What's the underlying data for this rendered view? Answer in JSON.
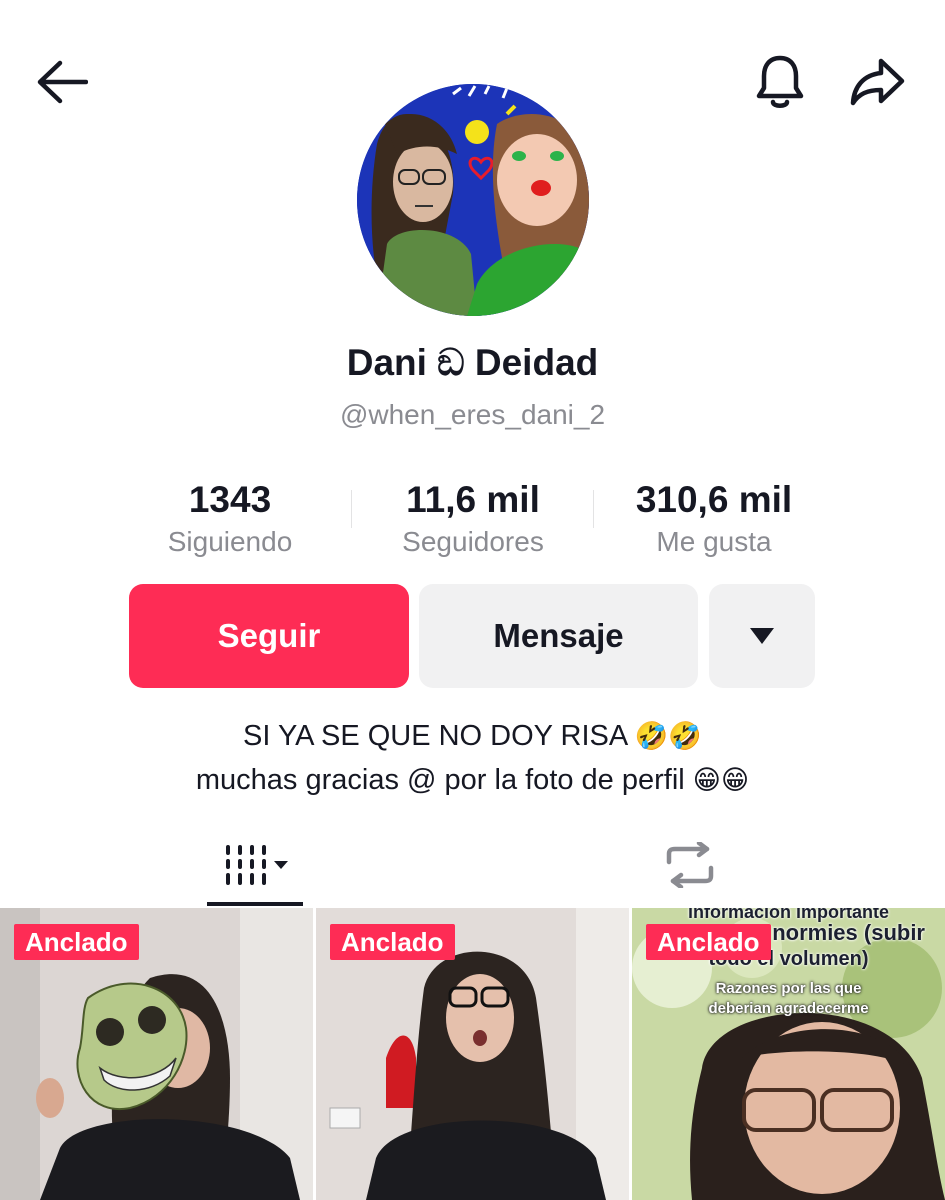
{
  "header": {
    "back_icon": "arrow-left-icon",
    "notification_icon": "bell-icon",
    "share_icon": "share-arrow-icon"
  },
  "profile": {
    "display_name": "Dani ඞ Deidad",
    "username": "@when_eres_dani_2",
    "avatar": "drawn-portrait-avatar"
  },
  "stats": [
    {
      "value": "1343",
      "label": "Siguiendo"
    },
    {
      "value": "11,6 mil",
      "label": "Seguidores"
    },
    {
      "value": "310,6 mil",
      "label": "Me gusta"
    }
  ],
  "actions": {
    "follow_label": "Seguir",
    "message_label": "Mensaje",
    "more_icon": "caret-down-icon"
  },
  "bio": {
    "line1_text": "SI YA SE QUE NO DOY RISA",
    "line1_emoji": "🤣🤣",
    "line2_text": "muchas gracias @ por la foto de perfil",
    "line2_emoji": "😁😁"
  },
  "tabs": {
    "videos_icon": "grid-columns-icon",
    "reposts_icon": "repost-icon"
  },
  "videos": [
    {
      "badge": "Anclado"
    },
    {
      "badge": "Anclado"
    },
    {
      "badge": "Anclado",
      "overlay_lines": [
        "información importante",
        "normies (subir",
        "todo el volumen)",
        "Razones por las que",
        "deberian agradecerme"
      ]
    }
  ],
  "colors": {
    "accent": "#fe2c55",
    "secondary_button": "#f1f1f2",
    "muted_text": "#8a8b91",
    "text": "#161823"
  }
}
